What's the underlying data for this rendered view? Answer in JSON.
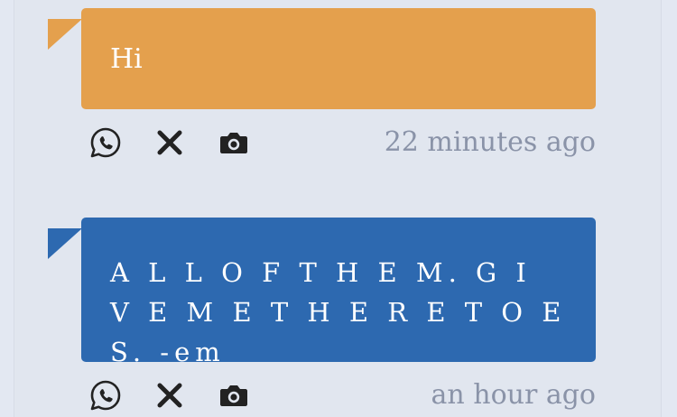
{
  "messages": [
    {
      "text": "Hi",
      "time": "22 minutes ago",
      "color": "#e4a04d"
    },
    {
      "text": "A L L O F T H E M. G I V E M E T H E R E T O E S. -em",
      "time": "an hour ago",
      "color": "#2d69b0"
    }
  ],
  "icons": {
    "share": "whatsapp-icon",
    "dismiss": "close-icon",
    "capture": "camera-icon"
  }
}
